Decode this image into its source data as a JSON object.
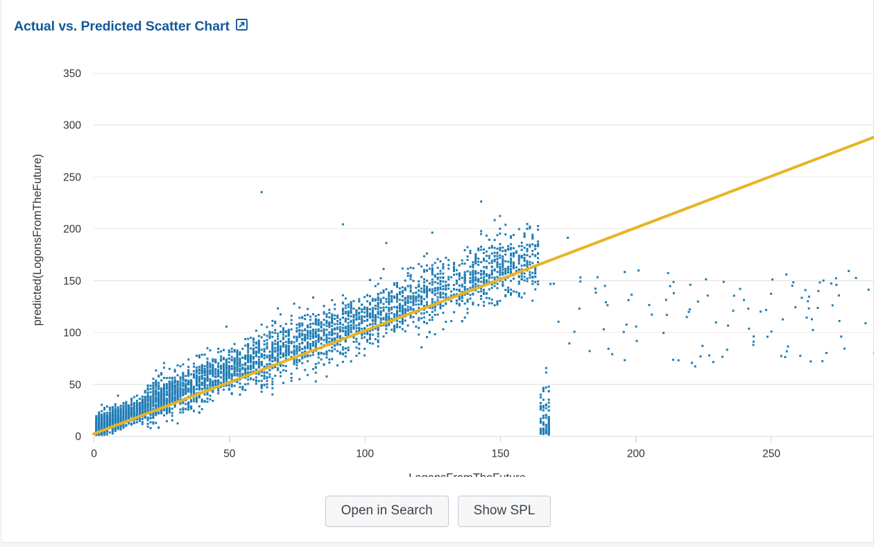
{
  "panel": {
    "title": "Actual vs. Predicted Scatter Chart",
    "open_icon": "external-link-icon"
  },
  "buttons": {
    "open_in_search": "Open in Search",
    "show_spl": "Show SPL"
  },
  "colors": {
    "title": "#13599a",
    "point": "#1f7cb4",
    "trendline": "#e8b325",
    "gridline": "#e8e8e8",
    "axis": "#d9dde2",
    "panel_bg": "#ffffff",
    "page_bg": "#f2f4f5"
  },
  "chart_data": {
    "type": "scatter",
    "title": "Actual vs. Predicted Scatter Chart",
    "xlabel": "LogonsFromTheFuture",
    "ylabel": "predicted(LogonsFromTheFuture)",
    "xlim": [
      0,
      288
    ],
    "ylim": [
      0,
      358
    ],
    "xticks": [
      0,
      50,
      100,
      150,
      200,
      250
    ],
    "yticks": [
      0,
      50,
      100,
      150,
      200,
      250,
      300,
      350
    ],
    "grid": "horizontal",
    "legend": "none",
    "series": [
      {
        "name": "predicted(LogonsFromTheFuture)",
        "type": "scatter",
        "color": "#1f7cb4",
        "marker_size": 3,
        "point_count": 4200,
        "description": "Dense positively-correlated cloud rising from origin, concentrated for x=0-160 with heteroscedastic spread widening with x; sparse outliers for x=160-290 mostly between y=65 and y=160; isolated high outlier near (62, 235).",
        "correlation": 0.86,
        "sample_points": [
          [
            2,
            6
          ],
          [
            3,
            9
          ],
          [
            4,
            12
          ],
          [
            5,
            10
          ],
          [
            6,
            15
          ],
          [
            7,
            13
          ],
          [
            8,
            18
          ],
          [
            9,
            16
          ],
          [
            10,
            20
          ],
          [
            11,
            18
          ],
          [
            12,
            24
          ],
          [
            13,
            21
          ],
          [
            14,
            27
          ],
          [
            15,
            23
          ],
          [
            16,
            30
          ],
          [
            18,
            33
          ],
          [
            20,
            36
          ],
          [
            22,
            40
          ],
          [
            24,
            42
          ],
          [
            26,
            46
          ],
          [
            28,
            48
          ],
          [
            30,
            52
          ],
          [
            32,
            55
          ],
          [
            35,
            58
          ],
          [
            38,
            62
          ],
          [
            40,
            66
          ],
          [
            45,
            72
          ],
          [
            50,
            78
          ],
          [
            55,
            84
          ],
          [
            60,
            90
          ],
          [
            65,
            95
          ],
          [
            70,
            100
          ],
          [
            75,
            104
          ],
          [
            80,
            108
          ],
          [
            85,
            112
          ],
          [
            90,
            116
          ],
          [
            95,
            120
          ],
          [
            100,
            124
          ],
          [
            105,
            127
          ],
          [
            110,
            130
          ],
          [
            115,
            133
          ],
          [
            120,
            136
          ],
          [
            125,
            139
          ],
          [
            130,
            142
          ],
          [
            135,
            145
          ],
          [
            140,
            148
          ],
          [
            145,
            150
          ],
          [
            150,
            152
          ],
          [
            155,
            155
          ],
          [
            62,
            235
          ],
          [
            92,
            204
          ],
          [
            143,
            226
          ],
          [
            148,
            208
          ],
          [
            150,
            212
          ],
          [
            125,
            196
          ],
          [
            108,
            186
          ],
          [
            175,
            191
          ],
          [
            186,
            153
          ],
          [
            196,
            158
          ],
          [
            212,
            157
          ],
          [
            222,
            67
          ],
          [
            226,
            151
          ],
          [
            250,
            137
          ],
          [
            268,
            148
          ],
          [
            274,
            152
          ],
          [
            286,
            141
          ],
          [
            206,
            117
          ],
          [
            190,
            84
          ],
          [
            196,
            73
          ],
          [
            220,
            122
          ],
          [
            240,
            131
          ]
        ],
        "cluster_bands": [
          {
            "x_range": [
              0,
              20
            ],
            "y_center_slope": 1.05,
            "y_spread": 14
          },
          {
            "x_range": [
              20,
              60
            ],
            "y_center_slope": 1.05,
            "y_spread": 26
          },
          {
            "x_range": [
              60,
              120
            ],
            "y_center_slope": 1.0,
            "y_spread": 34
          },
          {
            "x_range": [
              120,
              165
            ],
            "y_center_slope": 0.98,
            "y_spread": 40
          },
          {
            "x_range": [
              165,
              290
            ],
            "y_center_slope": 0.0,
            "y_spread": 45,
            "sparse": true
          }
        ]
      },
      {
        "name": "trend line",
        "type": "line",
        "color": "#e8b325",
        "width": 4,
        "points": [
          [
            0,
            2
          ],
          [
            288,
            288
          ]
        ],
        "slope": 0.993,
        "intercept": 2
      }
    ]
  }
}
